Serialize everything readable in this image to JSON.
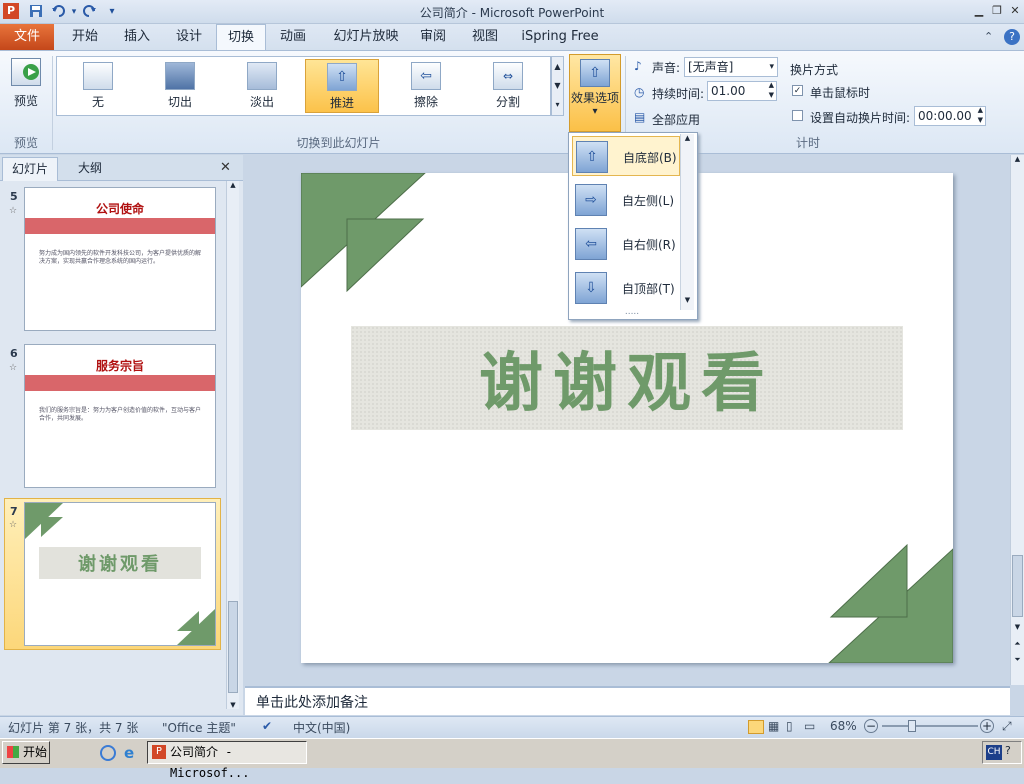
{
  "app": {
    "title": "公司简介 - Microsoft PowerPoint",
    "icon_letter": "P"
  },
  "quick_access": {
    "save_icon": "save-icon",
    "undo_icon": "undo-icon",
    "redo_icon": "redo-icon"
  },
  "ribbon_tabs": [
    "文件",
    "开始",
    "插入",
    "设计",
    "切换",
    "动画",
    "幻灯片放映",
    "审阅",
    "视图",
    "iSpring Free"
  ],
  "active_tab": "切换",
  "preview": {
    "label": "预览",
    "group": "预览"
  },
  "transitions": {
    "items": [
      "无",
      "切出",
      "淡出",
      "推进",
      "擦除",
      "分割"
    ],
    "selected": "推进",
    "group": "切换到此幻灯片"
  },
  "effect_options": {
    "label": "效果选项",
    "arrow": "▾"
  },
  "timing": {
    "sound_label": "声音:",
    "sound_value": "[无声音]",
    "duration_label": "持续时间:",
    "duration_value": "01.00",
    "apply_all": "全部应用",
    "advance_title": "换片方式",
    "on_click_label": "单击鼠标时",
    "on_click_checked": true,
    "auto_label": "设置自动换片时间:",
    "auto_checked": false,
    "auto_value": "00:00.00",
    "group": "计时"
  },
  "dropdown": {
    "items": [
      {
        "label": "自底部(B)",
        "icon": "arrow-up-icon"
      },
      {
        "label": "自左侧(L)",
        "icon": "arrow-right-icon"
      },
      {
        "label": "自右侧(R)",
        "icon": "arrow-left-icon"
      },
      {
        "label": "自顶部(T)",
        "icon": "arrow-down-icon"
      }
    ],
    "selected_index": 0,
    "grip": "....."
  },
  "left_panel": {
    "tabs": [
      "幻灯片",
      "大纲"
    ],
    "close": "✕",
    "slides": [
      {
        "num": "5",
        "title": "公司使命",
        "body": "努力成为国内领先的软件开发科技公司，为客户提供优质的解决方案，实现共赢合作理念系统的国内运行。"
      },
      {
        "num": "6",
        "title": "服务宗旨",
        "body": "我们的服务宗旨是：努力为客户创造价值的软件，互动与客户合作，共同发展。"
      },
      {
        "num": "7",
        "title": "谢谢观看",
        "body": ""
      }
    ]
  },
  "slide": {
    "banner_text": "谢谢观看"
  },
  "notes": {
    "placeholder": "单击此处添加备注"
  },
  "status": {
    "slide_info": "幻灯片 第 7 张，共 7 张",
    "theme": "\"Office 主题\"",
    "language": "中文(中国)",
    "zoom": "68%"
  },
  "taskbar": {
    "start": "开始",
    "task": "公司简介 - Microsof...",
    "tray": "CH"
  },
  "colors": {
    "accent_green": "#6f9a6a",
    "file_tab": "#d9582a",
    "selection": "#fcc24a"
  }
}
